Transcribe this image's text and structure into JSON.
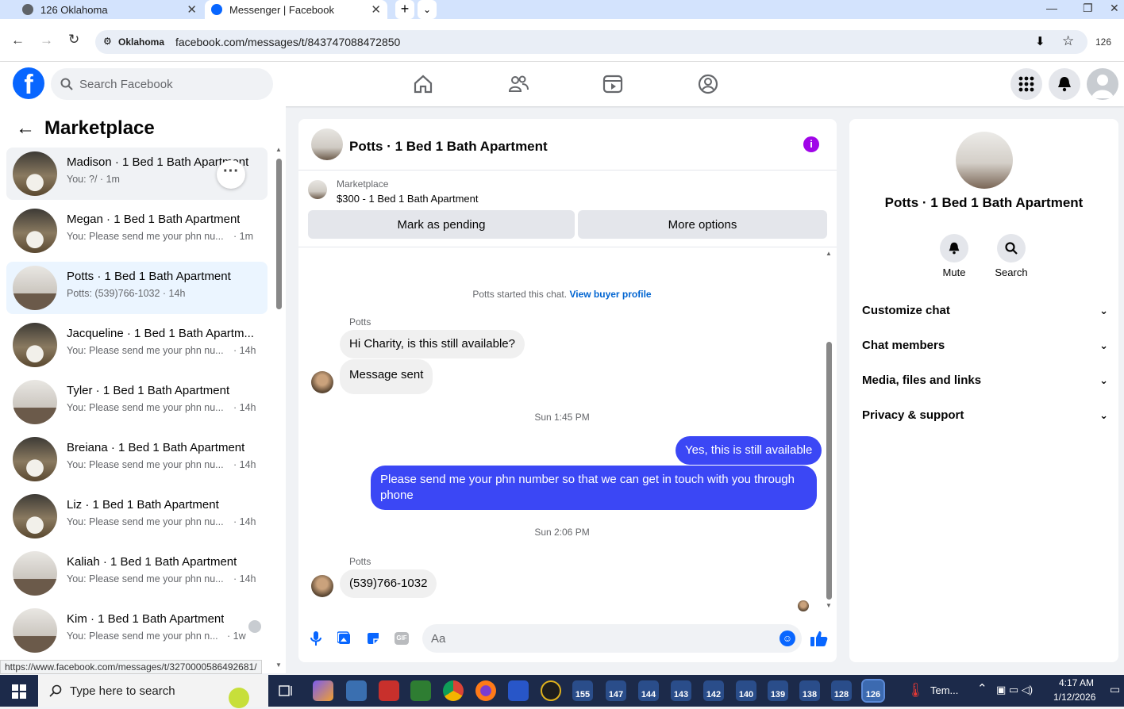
{
  "browser": {
    "tabs": [
      {
        "title": "126 Oklahoma"
      },
      {
        "title": "Messenger | Facebook"
      }
    ],
    "location_chip": "Oklahoma",
    "url": "facebook.com/messages/t/843747088472850",
    "right_badge": "126",
    "status_url": "https://www.facebook.com/messages/t/3270000586492681/"
  },
  "header": {
    "search_placeholder": "Search Facebook"
  },
  "sidebar": {
    "title": "Marketplace",
    "conversations": [
      {
        "title": "Madison · 1 Bed 1 Bath Apartment",
        "snippet": "You: ?/ · 1m",
        "time": "",
        "photo": "bed"
      },
      {
        "title": "Megan · 1 Bed 1 Bath Apartment",
        "snippet": "You: Please send me your phn nu...",
        "time": "· 1m",
        "photo": "bed"
      },
      {
        "title": "Potts · 1 Bed 1 Bath Apartment",
        "snippet": "Potts: (539)766-1032 · 14h",
        "time": "",
        "photo": "room"
      },
      {
        "title": "Jacqueline · 1 Bed 1 Bath Apartm...",
        "snippet": "You: Please send me your phn nu...",
        "time": "· 14h",
        "photo": "bed"
      },
      {
        "title": "Tyler · 1 Bed 1 Bath Apartment",
        "snippet": "You: Please send me your phn nu...",
        "time": "· 14h",
        "photo": "room"
      },
      {
        "title": "Breiana · 1 Bed 1 Bath Apartment",
        "snippet": "You: Please send me your phn nu...",
        "time": "· 14h",
        "photo": "bed"
      },
      {
        "title": "Liz · 1 Bed 1 Bath Apartment",
        "snippet": "You: Please send me your phn nu...",
        "time": "· 14h",
        "photo": "bed"
      },
      {
        "title": "Kaliah · 1 Bed 1 Bath Apartment",
        "snippet": "You: Please send me your phn nu...",
        "time": "· 14h",
        "photo": "room"
      },
      {
        "title": "Kim · 1 Bed 1 Bath Apartment",
        "snippet": "You: Please send me your phn n...",
        "time": "· 1w",
        "photo": "room"
      }
    ]
  },
  "chat": {
    "title": "Potts · 1 Bed 1 Bath Apartment",
    "listing_label": "Marketplace",
    "listing_detail": "$300 - 1 Bed 1 Bath Apartment",
    "mark_pending": "Mark as pending",
    "more_options": "More options",
    "started_text": "Potts started this chat.",
    "buyer_link": "View buyer profile",
    "sender_name": "Potts",
    "msg1": "Hi Charity, is this still available?",
    "msg2": "Message sent",
    "ts1": "Sun 1:45 PM",
    "msg3": "Yes, this is still available",
    "msg4": "Please send me your phn number so that we can get in touch with you through phone",
    "ts2": "Sun 2:06 PM",
    "msg5": "(539)766-1032",
    "composer_placeholder": "Aa"
  },
  "details": {
    "name": "Potts · 1 Bed 1 Bath Apartment",
    "mute": "Mute",
    "search": "Search",
    "sections": [
      "Customize chat",
      "Chat members",
      "Media, files and links",
      "Privacy & support"
    ]
  },
  "taskbar": {
    "search_placeholder": "Type here to search",
    "badges": [
      "155",
      "147",
      "144",
      "143",
      "142",
      "140",
      "139",
      "138",
      "128",
      "126"
    ],
    "weather": "Tem...",
    "time": "4:17 AM",
    "date": "1/12/2026"
  },
  "colors": {
    "fb_blue": "#0866ff",
    "outgoing": "#3b47f5",
    "info": "#a005e8"
  }
}
